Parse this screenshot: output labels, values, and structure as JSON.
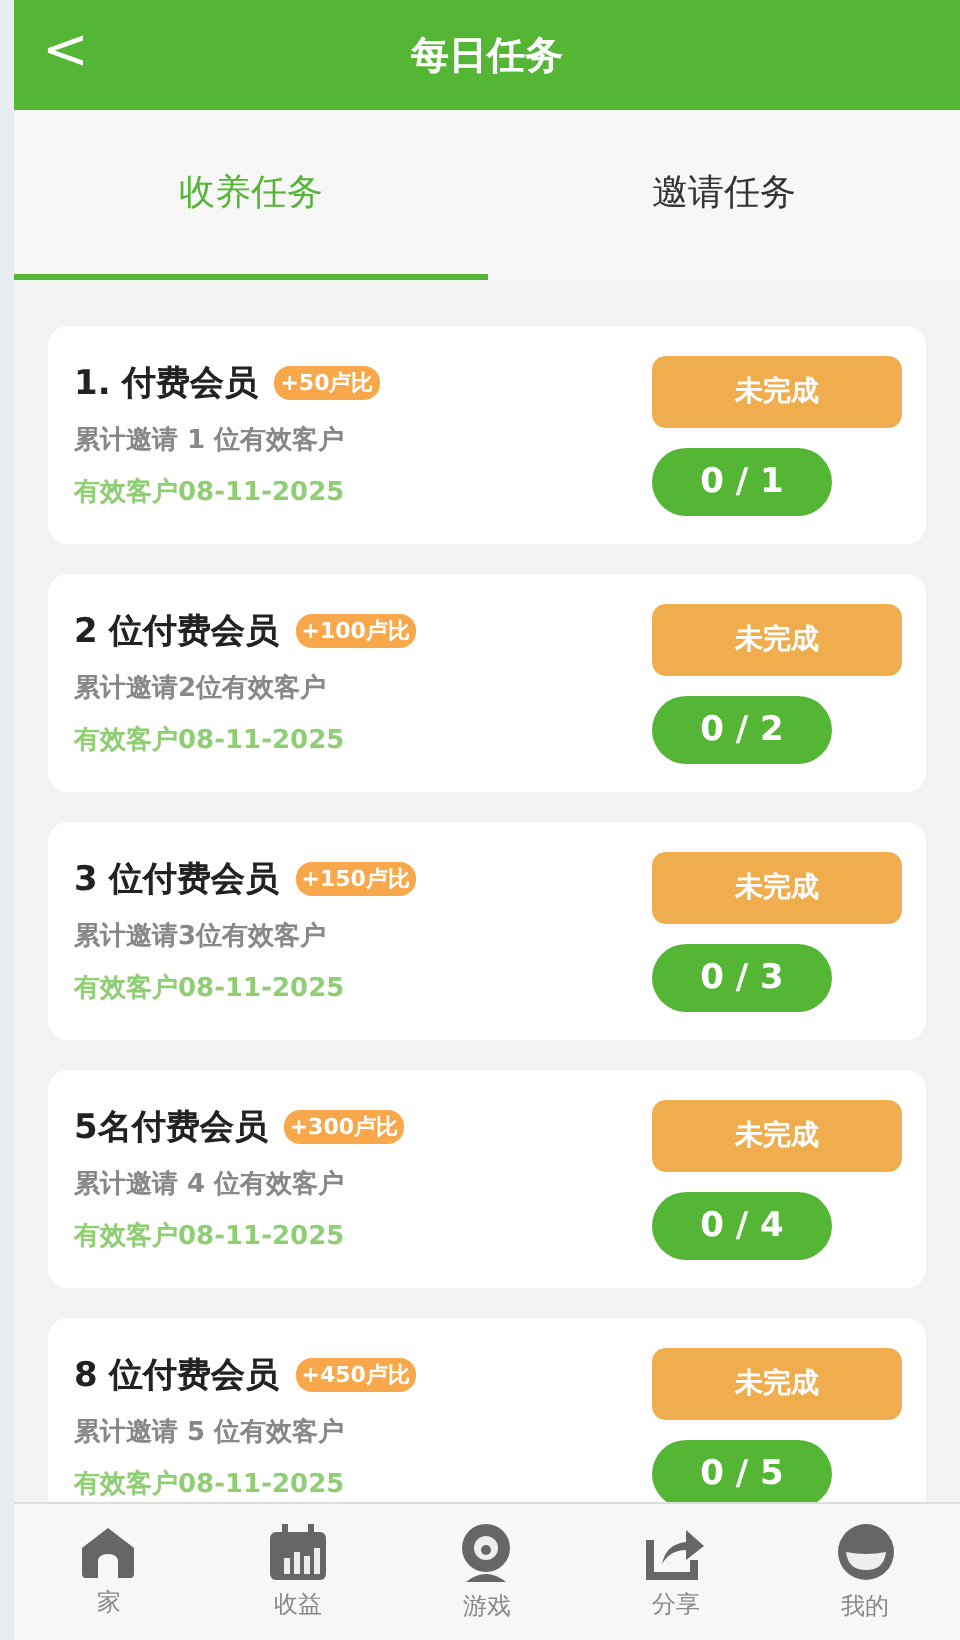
{
  "header": {
    "back": "<",
    "title": "每日任务"
  },
  "tabs": [
    {
      "label": "收养任务",
      "selected": true
    },
    {
      "label": "邀请任务",
      "selected": false
    }
  ],
  "tasks": [
    {
      "title": "1. 付费会员",
      "reward": "+50卢比",
      "desc": "累计邀请 1 位有效客户",
      "date": "有效客户08-11-2025",
      "status": "未完成",
      "progress": "0 / 1"
    },
    {
      "title": "2 位付费会员",
      "reward": "+100卢比",
      "desc": "累计邀请2位有效客户",
      "date": "有效客户08-11-2025",
      "status": "未完成",
      "progress": "0 / 2"
    },
    {
      "title": "3 位付费会员",
      "reward": "+150卢比",
      "desc": "累计邀请3位有效客户",
      "date": "有效客户08-11-2025",
      "status": "未完成",
      "progress": "0 / 3"
    },
    {
      "title": "5名付费会员",
      "reward": "+300卢比",
      "desc": "累计邀请 4 位有效客户",
      "date": "有效客户08-11-2025",
      "status": "未完成",
      "progress": "0 / 4"
    },
    {
      "title": "8 位付费会员",
      "reward": "+450卢比",
      "desc": "累计邀请 5 位有效客户",
      "date": "有效客户08-11-2025",
      "status": "未完成",
      "progress": "0 / 5"
    }
  ],
  "nav": [
    {
      "kind": "home",
      "label": "家"
    },
    {
      "kind": "calendar",
      "label": "收益"
    },
    {
      "kind": "camera",
      "label": "游戏"
    },
    {
      "kind": "share",
      "label": "分享"
    },
    {
      "kind": "profile",
      "label": "我的"
    }
  ]
}
